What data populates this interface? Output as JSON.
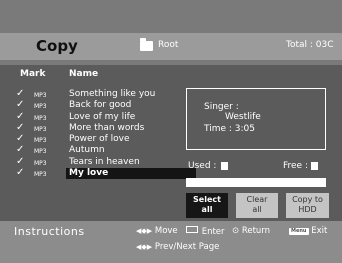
{
  "header": {
    "title": "Copy",
    "folder": "Root",
    "total": "Total : 03C"
  },
  "columns": {
    "mark": "Mark",
    "name": "Name"
  },
  "files": [
    {
      "badge": "MP3",
      "name": "Something like you"
    },
    {
      "badge": "MP3",
      "name": "Back for good"
    },
    {
      "badge": "MP3",
      "name": "Love of my life"
    },
    {
      "badge": "MP3",
      "name": "More than words"
    },
    {
      "badge": "MP3",
      "name": "Power of love"
    },
    {
      "badge": "MP3",
      "name": "Autumn"
    },
    {
      "badge": "MP3",
      "name": "Tears in heaven"
    },
    {
      "badge": "MP3",
      "name": "My love"
    }
  ],
  "info": {
    "singer_label": "Singer :",
    "singer": "Westlife",
    "time": "Time : 3:05"
  },
  "usage": {
    "used_label": "Used :",
    "free_label": "Free :"
  },
  "buttons": {
    "select_l1": "Select",
    "select_l2": "all",
    "clear_l1": "Clear",
    "clear_l2": "all",
    "copy_l1": "Copy to",
    "copy_l2": "HDD"
  },
  "instructions": {
    "label": "Instructions",
    "move": "Move",
    "enter": "Enter",
    "return": "Return",
    "menu_key": "Menu",
    "exit": "Exit",
    "page": "Prev/Next Page"
  }
}
